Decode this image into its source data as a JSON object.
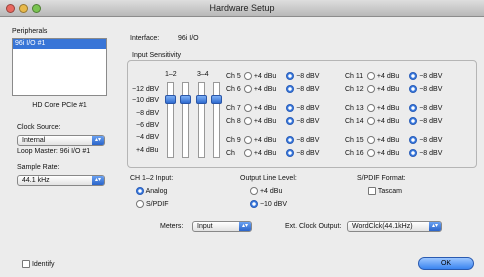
{
  "window": {
    "title": "Hardware Setup"
  },
  "peripherals": {
    "label": "Peripherals",
    "items": [
      "96i I/O #1"
    ],
    "device_name": "HD Core PCIe #1"
  },
  "clock": {
    "label": "Clock Source:",
    "value": "Internal",
    "loop_master": "Loop Master: 96i I/O #1"
  },
  "sample_rate": {
    "label": "Sample Rate:",
    "value": "44.1 kHz"
  },
  "interface": {
    "label": "Interface:",
    "value": "96i I/O"
  },
  "input_sensitivity": {
    "label": "Input Sensitivity",
    "fader_headers": [
      "1–2",
      "3–4"
    ],
    "scale": [
      "−12 dBV",
      "−10 dBV",
      "−8 dBV",
      "−6 dBV",
      "−4 dBV",
      "+4 dBu"
    ],
    "opt_plus": "+4 dBu",
    "opt_minus": "−8 dBV",
    "channels": [
      {
        "name": "Ch 5"
      },
      {
        "name": "Ch 6"
      },
      {
        "name": "Ch 7"
      },
      {
        "name": "Ch 8"
      },
      {
        "name": "Ch 9"
      },
      {
        "name": "Ch"
      },
      {
        "name": "Ch 11"
      },
      {
        "name": "Ch 12"
      },
      {
        "name": "Ch 13"
      },
      {
        "name": "Ch 14"
      },
      {
        "name": "Ch 15"
      },
      {
        "name": "Ch 16"
      }
    ]
  },
  "ch12_input": {
    "label": "CH 1–2 Input:",
    "options": [
      "Analog",
      "S/PDIF"
    ],
    "selected": "Analog"
  },
  "output_line_level": {
    "label": "Output Line Level:",
    "options": [
      "+4 dBu",
      "−10 dBV"
    ],
    "selected": "−10 dBV"
  },
  "spdif_format": {
    "label": "S/PDIF Format:",
    "option": "Tascam"
  },
  "meters": {
    "label": "Meters:",
    "value": "Input"
  },
  "ext_clock": {
    "label": "Ext. Clock Output:",
    "value": "WordClck(44.1kHz)"
  },
  "identify": {
    "label": "Identify"
  },
  "ok_button": {
    "label": "OK"
  },
  "colors": {
    "accent": "#3875d7",
    "window_bg": "#ececec"
  }
}
